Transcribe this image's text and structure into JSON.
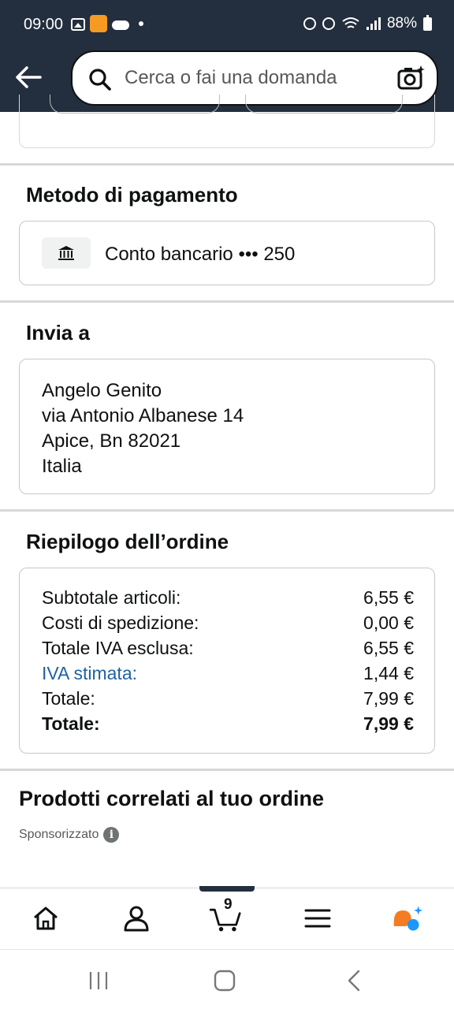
{
  "status_bar": {
    "time": "09:00",
    "battery": "88%"
  },
  "search": {
    "placeholder": "Cerca o fai una domanda"
  },
  "payment": {
    "title": "Metodo di pagamento",
    "method": "Conto bancario ••• 250"
  },
  "shipping": {
    "title": "Invia a",
    "lines": [
      "Angelo Genito",
      "via Antonio Albanese 14",
      "Apice, Bn 82021",
      "Italia"
    ]
  },
  "summary": {
    "title": "Riepilogo dell’ordine",
    "rows": [
      {
        "label": "Subtotale articoli:",
        "value": "6,55 €"
      },
      {
        "label": "Costi di spedizione:",
        "value": "0,00 €"
      },
      {
        "label": "Totale IVA esclusa:",
        "value": "6,55 €"
      },
      {
        "label": "IVA stimata:",
        "value": "1,44 €"
      },
      {
        "label": "Totale:",
        "value": "7,99 €"
      },
      {
        "label": "Totale:",
        "value": "7,99 €"
      }
    ]
  },
  "related": {
    "title": "Prodotti correlati al tuo ordine",
    "sponsored": "Sponsorizzato",
    "info_icon": "i"
  },
  "bottom_nav": {
    "cart_count": "9",
    "items": [
      "home-icon",
      "account-icon",
      "cart-icon",
      "menu-icon",
      "rufus-icon"
    ]
  },
  "colors": {
    "header_bg": "#232f3e",
    "link": "#2162a1",
    "rufus_orange": "#f57c22",
    "rufus_blue": "#1a98ff"
  }
}
